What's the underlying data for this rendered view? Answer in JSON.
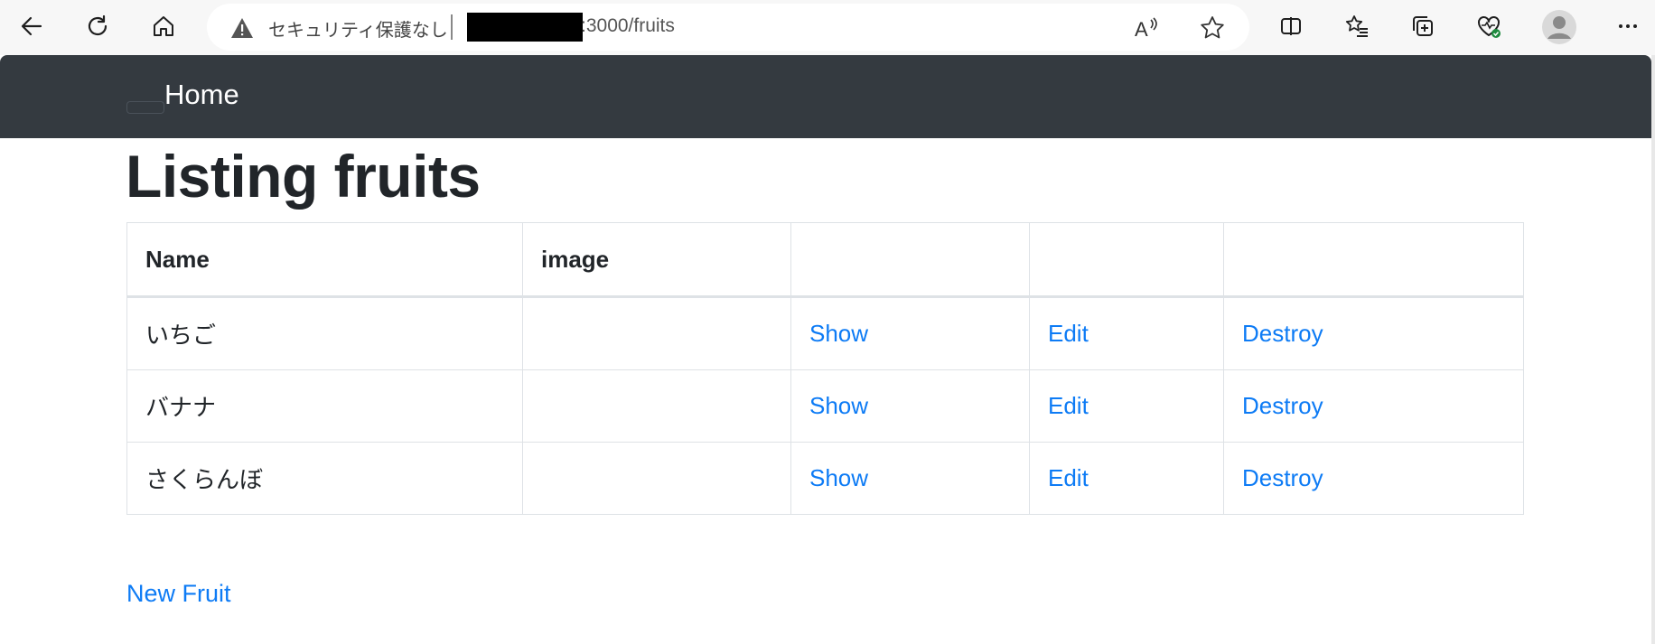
{
  "browser": {
    "security_text": "セキュリティ保護なし",
    "url_suffix": ":3000/fruits"
  },
  "navbar": {
    "brand": "Home"
  },
  "page": {
    "title": "Listing fruits",
    "new_link": "New Fruit"
  },
  "table": {
    "headers": [
      "Name",
      "image",
      "",
      "",
      ""
    ],
    "rows": [
      {
        "name": "いちご",
        "image": "",
        "show": "Show",
        "edit": "Edit",
        "destroy": "Destroy"
      },
      {
        "name": "バナナ",
        "image": "",
        "show": "Show",
        "edit": "Edit",
        "destroy": "Destroy"
      },
      {
        "name": "さくらんぼ",
        "image": "",
        "show": "Show",
        "edit": "Edit",
        "destroy": "Destroy"
      }
    ]
  },
  "colors": {
    "navbar_bg": "#343a40",
    "link": "#0d7bf5",
    "text": "#212529",
    "table_border": "#dee2e6"
  },
  "icons": [
    "back-icon",
    "refresh-icon",
    "home-icon",
    "warning-icon",
    "read-aloud-icon",
    "favorite-star-icon",
    "split-screen-icon",
    "favorites-list-icon",
    "collections-icon",
    "browser-essentials-icon",
    "profile-avatar-icon",
    "more-menu-icon"
  ]
}
